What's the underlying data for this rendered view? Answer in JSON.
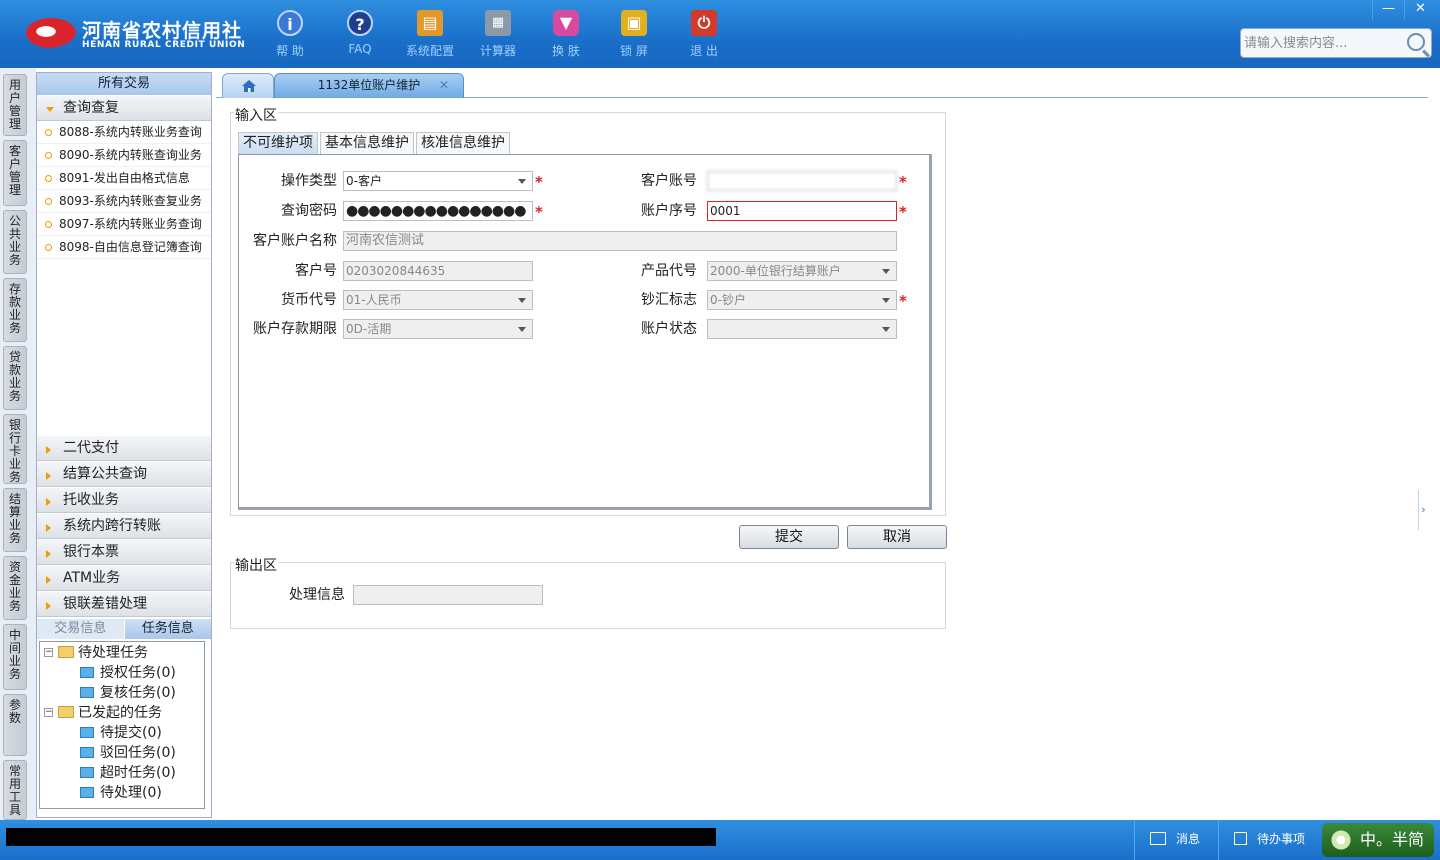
{
  "brand": {
    "name_cn": "河南省农村信用社",
    "name_en": "HENAN RURAL CREDIT UNION"
  },
  "toolbar": [
    {
      "icon": "info-icon",
      "label": "帮 助",
      "color": "#3a79d8"
    },
    {
      "icon": "faq-icon",
      "label": "FAQ",
      "color": "#1f3f8c"
    },
    {
      "icon": "toolbox-icon",
      "label": "系统配置",
      "color": "#e09a2a"
    },
    {
      "icon": "calculator-icon",
      "label": "计算器",
      "color": "#8a9aa8"
    },
    {
      "icon": "shirt-icon",
      "label": "换 肤",
      "color": "#d84aa0"
    },
    {
      "icon": "lock-icon",
      "label": "锁 屏",
      "color": "#e0b020"
    },
    {
      "icon": "power-icon",
      "label": "退 出",
      "color": "#d43a2a"
    }
  ],
  "window_controls": {
    "minimize": "—",
    "close": "✕"
  },
  "search": {
    "placeholder": "请输入搜索内容..."
  },
  "vertical_nav": [
    "用户管理",
    "客户管理",
    "公共业务",
    "存款业务",
    "贷款业务",
    "银行卡业务",
    "结算业务",
    "资金业务",
    "中间业务",
    "参数",
    "常用工具"
  ],
  "left_panel": {
    "header": "所有交易",
    "open_group": "查询查复",
    "transactions": [
      "8088-系统内转账业务查询",
      "8090-系统内转账查询业务",
      "8091-发出自由格式信息",
      "8093-系统内转账查复业务",
      "8097-系统内转账业务查询",
      "8098-自由信息登记簿查询"
    ],
    "groups": [
      "二代支付",
      "结算公共查询",
      "托收业务",
      "系统内跨行转账",
      "银行本票",
      "ATM业务",
      "银联差错处理"
    ],
    "info_tabs": {
      "trade": "交易信息",
      "task": "任务信息"
    },
    "tree": {
      "pending": "待处理任务",
      "auth": "授权任务(0)",
      "review": "复核任务(0)",
      "initiated": "已发起的任务",
      "to_submit": "待提交(0)",
      "rejected": "驳回任务(0)",
      "timeout": "超时任务(0)",
      "to_process": "待处理(0)"
    }
  },
  "tabs": {
    "doc": "1132单位账户维护",
    "close": "✕"
  },
  "input_area": {
    "title": "输入区",
    "subtabs": [
      "不可维护项",
      "基本信息维护",
      "核准信息维护"
    ],
    "fields": {
      "op_type": {
        "label": "操作类型",
        "value": "0-客户"
      },
      "cust_account": {
        "label": "客户账号",
        "value": ""
      },
      "query_pwd": {
        "label": "查询密码",
        "value": "●●●●●●●●●●●●●●●●"
      },
      "account_seq": {
        "label": "账户序号",
        "value": "0001"
      },
      "cust_account_name": {
        "label": "客户账户名称",
        "value": "河南农信测试"
      },
      "cust_no": {
        "label": "客户号",
        "value": "0203020844635"
      },
      "product_code": {
        "label": "产品代号",
        "value": "2000-单位银行结算账户"
      },
      "currency": {
        "label": "货币代号",
        "value": "01-人民币"
      },
      "cash_flag": {
        "label": "钞汇标志",
        "value": "0-钞户"
      },
      "term": {
        "label": "账户存款期限",
        "value": "0D-活期"
      },
      "status": {
        "label": "账户状态",
        "value": ""
      }
    },
    "required_mark": "*"
  },
  "buttons": {
    "submit": "提交",
    "cancel": "取消"
  },
  "output_area": {
    "title": "输出区",
    "proc_label": "处理信息",
    "proc_value": ""
  },
  "statusbar": {
    "message": "消息",
    "todo": "待办事项",
    "ime": "中。半简"
  }
}
